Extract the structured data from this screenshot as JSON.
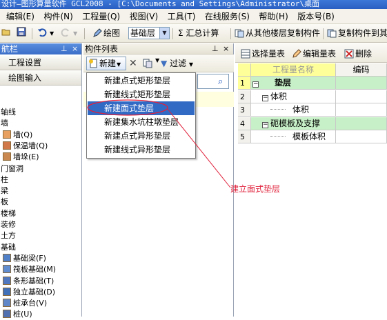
{
  "window": {
    "title": "设计—图形算量软件 GCL2008 - [C:\\Documents and Settings\\Administrator\\桌面"
  },
  "menu": [
    "编辑(E)",
    "构件(N)",
    "工程量(Q)",
    "视图(V)",
    "工具(T)",
    "在线服务(S)",
    "帮助(H)",
    "版本号(B)"
  ],
  "toolbar": {
    "draw_label": "绘图",
    "floor_value": "基础层",
    "sum_label": "Σ 汇总计算",
    "copy_from_other": "从其他楼层复制构件",
    "copy_to": "复制构件到其"
  },
  "nav": {
    "title": "航栏",
    "pin": "ഹ",
    "close": "×",
    "buttons": [
      "工程设置",
      "绘图输入"
    ],
    "tree": [
      {
        "label": "轴线",
        "icon": ""
      },
      {
        "label": "墙",
        "icon": ""
      },
      {
        "label": "墙(Q)",
        "icon": "wall-icon",
        "indent": true
      },
      {
        "label": "保温墙(Q)",
        "icon": "insulation-wall-icon",
        "indent": true
      },
      {
        "label": "墙垛(E)",
        "icon": "wall-pier-icon",
        "indent": true
      },
      {
        "label": "门窗洞",
        "icon": ""
      },
      {
        "label": "柱",
        "icon": ""
      },
      {
        "label": "梁",
        "icon": ""
      },
      {
        "label": "板",
        "icon": ""
      },
      {
        "label": "楼梯",
        "icon": ""
      },
      {
        "label": "装修",
        "icon": ""
      },
      {
        "label": "土方",
        "icon": ""
      },
      {
        "label": "基础",
        "icon": ""
      },
      {
        "label": "基础梁(F)",
        "icon": "foundation-beam-icon",
        "indent": true
      },
      {
        "label": "筏板基础(M)",
        "icon": "raft-foundation-icon",
        "indent": true
      },
      {
        "label": "条形基础(T)",
        "icon": "strip-foundation-icon",
        "indent": true
      },
      {
        "label": "独立基础(D)",
        "icon": "isolated-foundation-icon",
        "indent": true
      },
      {
        "label": "桩承台(V)",
        "icon": "pile-cap-icon",
        "indent": true
      },
      {
        "label": "桩(U)",
        "icon": "pile-icon",
        "indent": true
      }
    ]
  },
  "component_list": {
    "title": "构件列表",
    "pin": "ഹ",
    "close": "×",
    "new_label": "新建",
    "filter_label": "过滤"
  },
  "dropdown": {
    "items": [
      "新建点式矩形垫层",
      "新建线式矩形垫层",
      "新建面式垫层",
      "新建集水坑柱墩垫层",
      "新建点式异形垫层",
      "新建线式异形垫层"
    ],
    "selected_index": 2
  },
  "right": {
    "select_label": "选择量表",
    "edit_label": "编辑量表",
    "delete_label": "删除",
    "col_name": "工程量名称",
    "col_code": "编码",
    "rows": [
      {
        "num": "1",
        "name": "垫层",
        "level": 0,
        "expander": true
      },
      {
        "num": "2",
        "name": "体积",
        "level": 1,
        "expander": true
      },
      {
        "num": "3",
        "name": "体积",
        "level": 2,
        "expander": false
      },
      {
        "num": "4",
        "name": "砈模板及支撑",
        "level": 1,
        "expander": true
      },
      {
        "num": "5",
        "name": "模板体积",
        "level": 2,
        "expander": false
      }
    ]
  },
  "annotation": {
    "text": "建立面式垫层",
    "color": "#e0203a"
  },
  "colors": {
    "accent": "#316ac5",
    "row_highlight": "#c8f0c8",
    "header_yellow": "#ffff99"
  }
}
